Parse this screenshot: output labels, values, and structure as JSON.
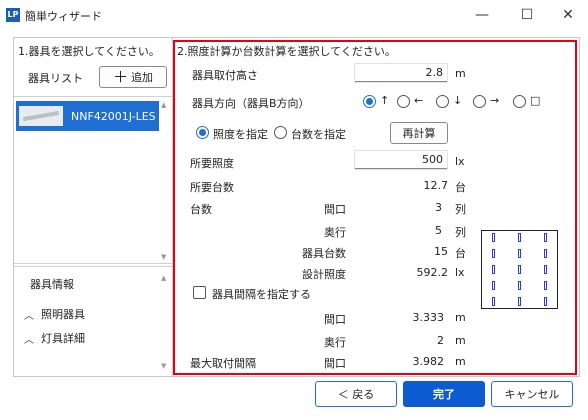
{
  "window": {
    "app_icon": "LP",
    "title": "簡単ウィザード",
    "minimize_icon": "—",
    "maximize_icon": "☐",
    "close_icon": "✕"
  },
  "left": {
    "step_title": "1.器具を選択してください。",
    "list_label": "器具リスト",
    "add_button": {
      "icon": "＋",
      "label": "追加"
    },
    "items": [
      {
        "label": "NNF42001J-LES"
      }
    ],
    "info_title": "器具情報",
    "tree": [
      {
        "label": "照明器具"
      },
      {
        "label": "灯具詳細"
      }
    ]
  },
  "right": {
    "step_title": "2.照度計算か台数計算を選択してください。",
    "mount_height": {
      "label": "器具取付高さ",
      "value": "2.8",
      "unit": "m"
    },
    "direction": {
      "label": "器具方向（器具B方向）",
      "options": [
        {
          "glyph": "↑",
          "selected": true
        },
        {
          "glyph": "←",
          "selected": false
        },
        {
          "glyph": "↓",
          "selected": false
        },
        {
          "glyph": "→",
          "selected": false
        },
        {
          "glyph": "□",
          "selected": false
        }
      ]
    },
    "mode": {
      "illuminance_label": "照度を指定",
      "count_label": "台数を指定",
      "selected": "illuminance"
    },
    "recalc_button": "再計算",
    "required_illuminance": {
      "label": "所要照度",
      "value": "500",
      "unit": "lx"
    },
    "required_count": {
      "label": "所要台数",
      "value": "12.7",
      "unit": "台"
    },
    "count_label": "台数",
    "frontage": {
      "label": "間口",
      "value": "3",
      "unit": "列"
    },
    "depth": {
      "label": "奥行",
      "value": "5",
      "unit": "列"
    },
    "fixture_count": {
      "label": "器具台数",
      "value": "15",
      "unit": "台"
    },
    "design_illuminance": {
      "label": "設計照度",
      "value": "592.2",
      "unit": "lx"
    },
    "spacing_checkbox": {
      "label": "器具間隔を指定する",
      "checked": false
    },
    "spacing_frontage": {
      "label": "間口",
      "value": "3.333",
      "unit": "m"
    },
    "spacing_depth": {
      "label": "奥行",
      "value": "2",
      "unit": "m"
    },
    "max_spacing": {
      "label": "最大取付間隔",
      "sub_label": "間口",
      "value": "3.982",
      "unit": "m"
    },
    "layout_preview": {
      "columns": 3,
      "rows": 5,
      "lamp_color": "#2c3bd8"
    }
  },
  "footer": {
    "back_button": "＜ 戻る",
    "finish_button": "完了",
    "cancel_button": "キャンセル"
  },
  "colors": {
    "accent": "#1f6ed4",
    "highlight_frame": "#e60012"
  }
}
